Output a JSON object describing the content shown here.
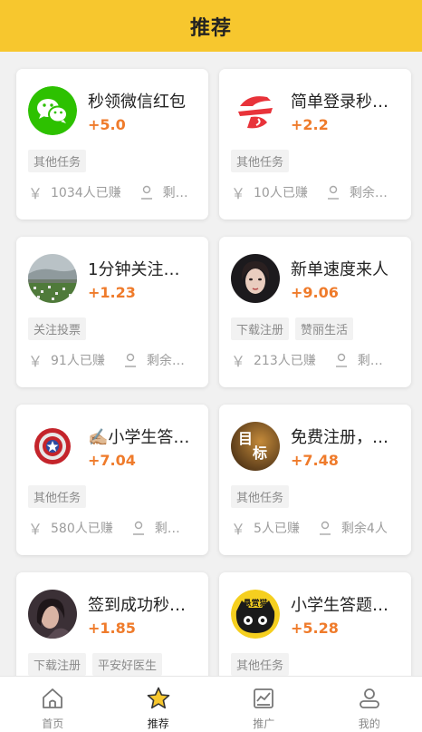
{
  "header": {
    "title": "推荐"
  },
  "cards": [
    {
      "title": "秒领微信红包",
      "reward": "+5.0",
      "tags": [
        "其他任务"
      ],
      "earned": "1034人已赚",
      "remain": "剩…",
      "icon": "wechat-logo"
    },
    {
      "title": "简单登录秒…",
      "reward": "+2.2",
      "tags": [
        "其他任务"
      ],
      "earned": "10人已赚",
      "remain": "剩余…",
      "icon": "red-brand-logo"
    },
    {
      "title": "1分钟关注…",
      "reward": "+1.23",
      "tags": [
        "关注投票"
      ],
      "earned": "91人已赚",
      "remain": "剩余…",
      "icon": "landscape-photo"
    },
    {
      "title": "新单速度来人",
      "reward": "+9.06",
      "tags": [
        "下载注册",
        "赞丽生活"
      ],
      "earned": "213人已赚",
      "remain": "剩…",
      "icon": "portrait-photo"
    },
    {
      "title": "✍🏼小学生答…",
      "reward": "+7.04",
      "tags": [
        "其他任务"
      ],
      "earned": "580人已赚",
      "remain": "剩…",
      "icon": "captain-shield-logo"
    },
    {
      "title": "免费注册，…",
      "reward": "+7.48",
      "tags": [
        "其他任务"
      ],
      "earned": "5人已赚",
      "remain": "剩余4人",
      "icon": "target-text-logo"
    },
    {
      "title": "签到成功秒…",
      "reward": "+1.85",
      "tags": [
        "下载注册",
        "平安好医生"
      ],
      "earned": "",
      "remain": "",
      "icon": "portrait-photo-2"
    },
    {
      "title": "小学生答题…",
      "reward": "+5.28",
      "tags": [
        "其他任务"
      ],
      "earned": "",
      "remain": "",
      "icon": "bounty-cat-logo"
    }
  ],
  "avatar_texts": {
    "target": [
      "目",
      "标"
    ],
    "bounty": "悬赏猫"
  },
  "currency_symbol": "￥",
  "tabs": [
    {
      "label": "首页",
      "icon": "home-icon",
      "active": false
    },
    {
      "label": "推荐",
      "icon": "star-icon",
      "active": true
    },
    {
      "label": "推广",
      "icon": "chart-icon",
      "active": false
    },
    {
      "label": "我的",
      "icon": "user-icon",
      "active": false
    }
  ],
  "colors": {
    "accent": "#f7c72e",
    "reward": "#ef7b2b",
    "wechat": "#2dc100"
  }
}
